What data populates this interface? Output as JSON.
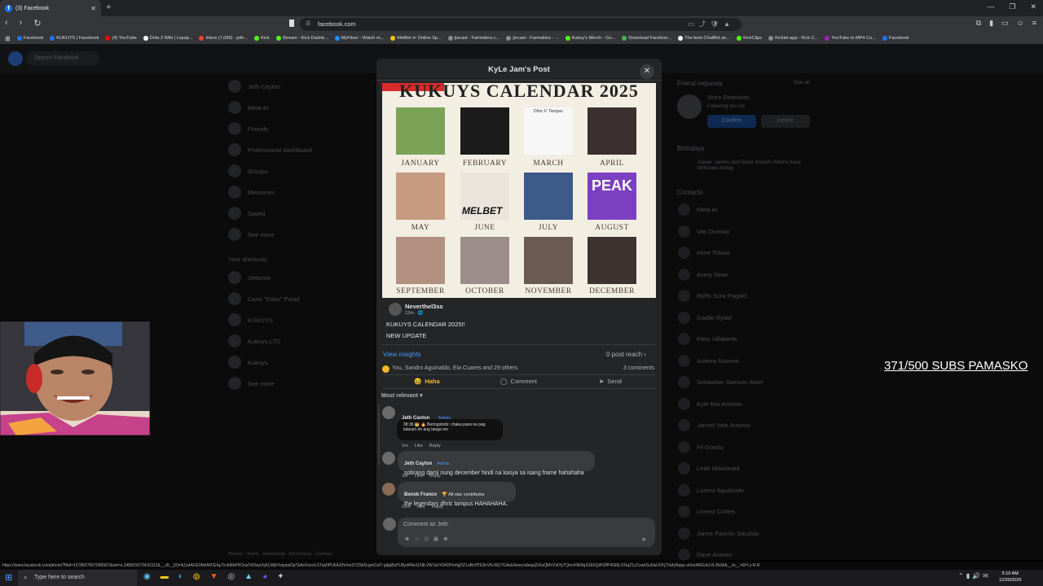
{
  "browser": {
    "tab_title": "(3) Facebook",
    "url": "facebook.com",
    "bookmarks": [
      {
        "label": "Facebook",
        "color": "#1877f2"
      },
      {
        "label": "KUKUYS | Facebook",
        "color": "#1877f2"
      },
      {
        "label": "(4) YouTube",
        "color": "#ff0000"
      },
      {
        "label": "Dota 2 Wiki | Liquip...",
        "color": "#ffffff"
      },
      {
        "label": "Inbox (7,099) - jeth...",
        "color": "#ea4335"
      },
      {
        "label": "Kick",
        "color": "#53fc18"
      },
      {
        "label": "Stream - Kick Dashb...",
        "color": "#53fc18"
      },
      {
        "label": "MyFlixer - Watch m...",
        "color": "#1e90ff"
      },
      {
        "label": "MelBet ⊳ Online Sp...",
        "color": "#f5c518"
      },
      {
        "label": "jtzcast - Farmskins.c...",
        "color": "#8a8a8a"
      },
      {
        "label": "jtzcast - Farmskins - ...",
        "color": "#8a8a8a"
      },
      {
        "label": "Kukuy's Merch - Go...",
        "color": "#53fc18"
      },
      {
        "label": "Download Faceboo...",
        "color": "#4caf50"
      },
      {
        "label": "The best ChatBot an...",
        "color": "#ffffff"
      },
      {
        "label": "KickClips",
        "color": "#53fc18"
      },
      {
        "label": "Kicklet.app - Kick C...",
        "color": "#8a8a8a"
      },
      {
        "label": "YouTube to MP4 Co...",
        "color": "#9c27b0"
      },
      {
        "label": "Facebook",
        "color": "#1877f2"
      }
    ],
    "status_url": "https://www.facebook.com/photo/?fbid=1578657657099367&set=a.248831673415312&__cft__[0]=AZa4AUE9MeNfCEApTrcbMoPKOvpTkDtasXyKLWjkYoqvpsDpTkAnXoxoLSTuk0PUhA39Vme2YZSk5cgmCoiT-gdjqBzPLByd4Ne11N8-2W1dsY64DPnirfgDZ1uBcHTE8cVN-68J7GAeb9eeectdsqej3XIaQMVZvFfyTQmnHENq3S8XQdHZfP4GlltLOGqZ1yCswkSu0wUVFj7VafyNqqe-uhhol40GzkJ-8-3b9A&__tn__=EH-y-R-R"
  },
  "facebook": {
    "search_placeholder": "Search Facebook",
    "left_sidebar": [
      "Jeth Cayton",
      "Meta AI",
      "Friends",
      "Professional dashboard",
      "Groups",
      "Memories",
      "Saved",
      "See more"
    ],
    "shortcuts_heading": "Your shortcuts",
    "shortcuts": [
      "Jettezee",
      "Cario \"Kuku\" Palad",
      "KUKUYS",
      "Kukuys LTD",
      "Kukuys",
      "See more"
    ],
    "friend_requests_heading": "Friend requests",
    "see_all": "See all",
    "request_name": "Vince Estanislao",
    "request_sub": "Following you 2w",
    "confirm": "Confirm",
    "delete": "Delete",
    "birthdays_heading": "Birthdays",
    "birthday_text": "Xavier James and Basil Joseph Rillera have birthdays today.",
    "contacts_heading": "Contacts",
    "contacts": [
      "Meta AI",
      "Van Dumlao",
      "Irene Tobias",
      "Avery Sean",
      "Ruffo Sora Pagaid",
      "Gaelle Rydel",
      "Klein Villaberte",
      "Andrea Moreno",
      "Sebastian Samson Aiser",
      "Kyle Mai Antonio",
      "Jannel Vale Antonio",
      "Fil Gonda",
      "Leah Masilantia",
      "Lorenz Aguilondo",
      "Lorenz Cortes",
      "Jaime Pancito Sacalda",
      "Dave Asaves"
    ],
    "footer": "Privacy · Terms · Advertising · Ad Choices · Cookies"
  },
  "modal": {
    "title": "KyLe Jam's Post",
    "calendar": {
      "title": "KUKUYS CALENDAR 2025",
      "months": [
        "JANUARY",
        "FEBRUARY",
        "MARCH",
        "APRIL",
        "MAY",
        "JUNE",
        "JULY",
        "AUGUST",
        "SEPTEMBER",
        "OCTOBER",
        "NOVEMBER",
        "DECEMBER"
      ],
      "march_card_name": "Dhric F. Tampus",
      "melbet": "MELBET",
      "peak": "PEAK"
    },
    "post": {
      "author": "Neverthel3ss",
      "time": "12m · 🌐",
      "line1": "KUKUYS CALENDAR 2025!!",
      "line2": "NEW UPDATE"
    },
    "insights": "View insights",
    "reach": "0 post reach",
    "reactions": "You, Sandro Aguinaldo, Ela Cuares and 29 others",
    "comments_count": "3 comments",
    "actions": {
      "haha": "Haha",
      "comment": "Comment",
      "send": "Send"
    },
    "sort": "Most relevant",
    "comments": [
      {
        "name": "Jeth Cayton",
        "badge": "Admin",
        "sticker_line1": "38:36 👑 🔥 Benngstodz: chaka pano ka pag",
        "sticker_line2": "lalaruin eh ang tanga mo",
        "time": "1m",
        "like": "Like",
        "reply": "Reply"
      },
      {
        "name": "Jeth Cayton",
        "badge": "Admin",
        "text": "sobrang dami nung december hindi na kasya sa isang frame hahahaha",
        "time": "1m",
        "like": "Like",
        "reply": "Reply"
      },
      {
        "name": "Benok Franco",
        "badge": "🏆 All-star contributor",
        "text": "the legendary dhric tampus HAHAHAHA.",
        "time": "10m",
        "like": "Like",
        "reply": "Reply"
      }
    ],
    "comment_placeholder": "Comment as Jeth"
  },
  "overlay_text": "371/500 SUBS PAMASKO",
  "taskbar": {
    "search_placeholder": "Type here to search",
    "time": "5:10 AM",
    "date": "12/30/2025"
  }
}
